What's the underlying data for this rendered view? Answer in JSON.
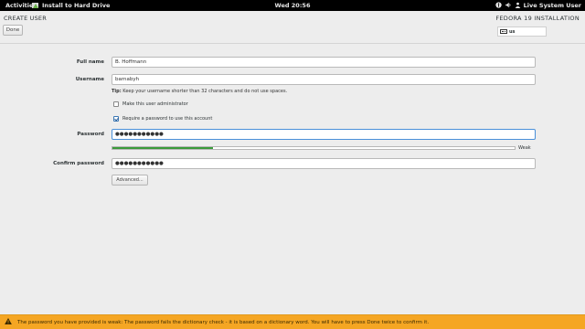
{
  "topbar": {
    "activities": "Activities",
    "app_name": "Install to Hard Drive",
    "clock": "Wed 20:56",
    "user": "Live System User"
  },
  "header": {
    "page_title": "CREATE USER",
    "done_label": "Done",
    "install_title": "FEDORA 19 INSTALLATION",
    "keyboard_layout": "us"
  },
  "form": {
    "full_name_label": "Full name",
    "full_name_value": "B. Hoffmann",
    "username_label": "Username",
    "username_value": "barnabyh",
    "tip_prefix": "Tip:",
    "tip_text": " Keep your username shorter than 32 characters and do not use spaces.",
    "make_admin_label": "Make this user administrator",
    "make_admin_checked": false,
    "require_password_label": "Require a password to use this account",
    "require_password_checked": true,
    "password_label": "Password",
    "password_value": "●●●●●●●●●●●",
    "strength_fraction": 0.25,
    "strength_label": "Weak",
    "confirm_label": "Confirm password",
    "confirm_value": "●●●●●●●●●●●",
    "advanced_label": "Advanced..."
  },
  "warning": {
    "text": "The password you have provided is weak: The password fails the dictionary check - it is based on a dictionary word. You will have to press Done twice to confirm it.",
    "color": "#f5a623"
  }
}
